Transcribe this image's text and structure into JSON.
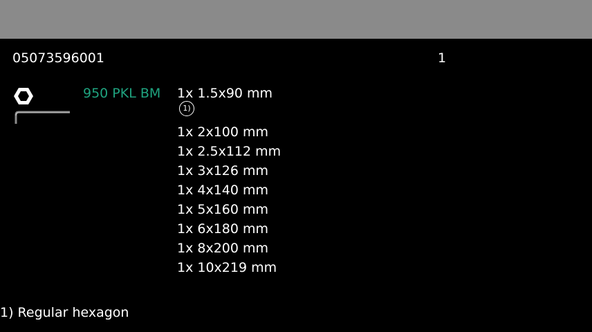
{
  "header": {
    "article_number": "05073596001",
    "quantity": "1"
  },
  "product": {
    "icon": "hex-key-icon",
    "name": "950 PKL BM",
    "name_color": "#1fa37f"
  },
  "items": [
    {
      "label": "1x 1.5x90 mm",
      "footnote_marker": "1)"
    },
    {
      "label": "1x 2x100 mm"
    },
    {
      "label": "1x 2.5x112 mm"
    },
    {
      "label": "1x 3x126 mm"
    },
    {
      "label": "1x 4x140 mm"
    },
    {
      "label": "1x 5x160 mm"
    },
    {
      "label": "1x 6x180 mm"
    },
    {
      "label": "1x 8x200 mm"
    },
    {
      "label": "1x 10x219 mm"
    }
  ],
  "footnote": "1) Regular hexagon"
}
